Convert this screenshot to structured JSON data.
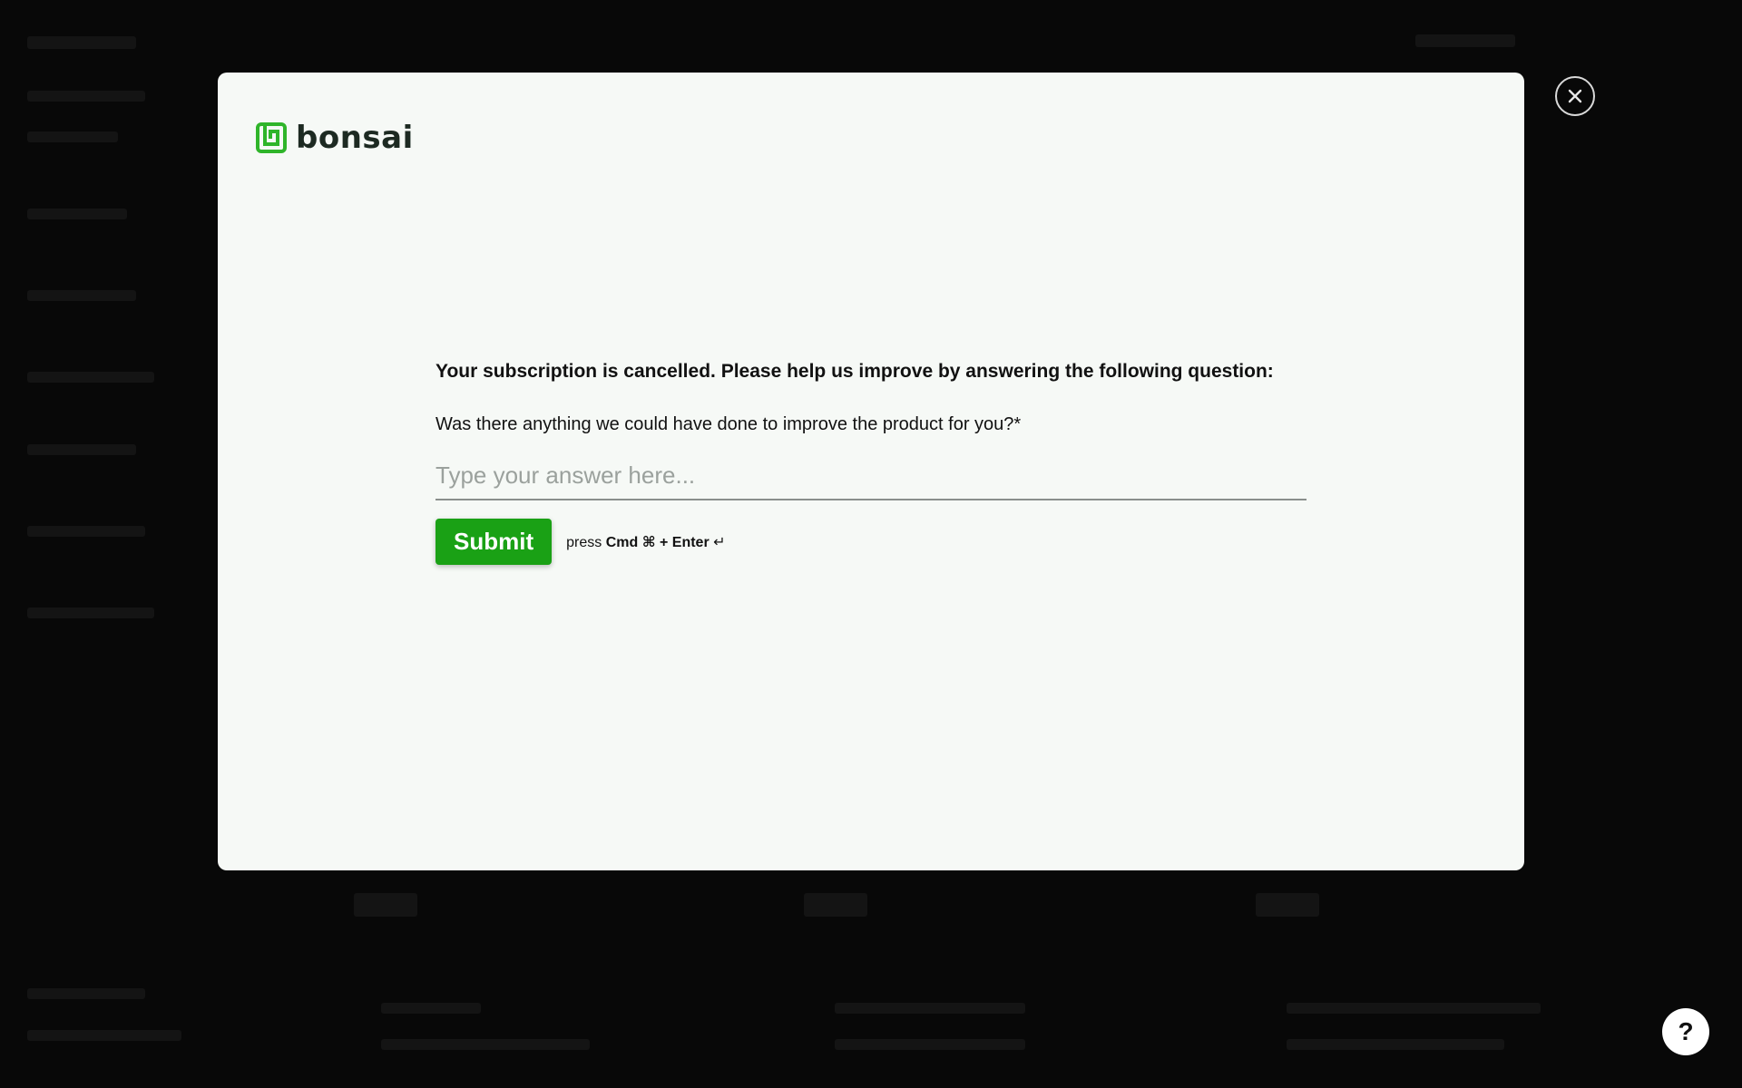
{
  "brand": {
    "name": "bonsai",
    "accent": "#1aa115"
  },
  "survey": {
    "headline": "Your subscription is cancelled. Please help us improve by answering the following question:",
    "question": "Was there anything we could have done to improve the product for you?*",
    "answer_placeholder": "Type your answer here...",
    "answer_value": "",
    "submit_label": "Submit",
    "hint_prefix": "press",
    "hint_keys": "Cmd ⌘ + Enter",
    "hint_suffix": "↵"
  },
  "controls": {
    "close_icon": "close-icon",
    "help_label": "?"
  }
}
